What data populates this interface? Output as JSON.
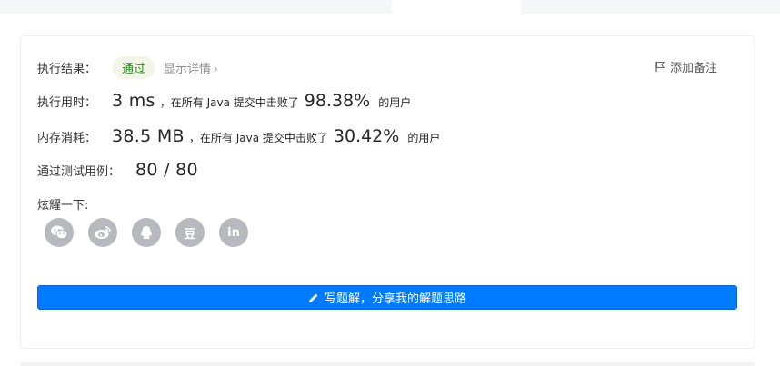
{
  "result": {
    "label": "执行结果：",
    "status": "通过",
    "details_link": "显示详情",
    "details_chevron": "›",
    "add_note": "添加备注"
  },
  "runtime": {
    "label": "执行用时：",
    "value": "3 ms",
    "text_before": "，在所有 Java 提交中击败了",
    "percent": "98.38%",
    "text_after": "的用户"
  },
  "memory": {
    "label": "内存消耗：",
    "value": "38.5 MB",
    "text_before": "，在所有 Java 提交中击败了",
    "percent": "30.42%",
    "text_after": "的用户"
  },
  "tests": {
    "label": "通过测试用例：",
    "value": "80 / 80"
  },
  "share": {
    "label": "炫耀一下:",
    "buttons": [
      {
        "name": "wechat-icon"
      },
      {
        "name": "weibo-icon"
      },
      {
        "name": "qq-icon"
      },
      {
        "name": "douban-icon",
        "glyph": "豆"
      },
      {
        "name": "linkedin-icon",
        "glyph": "in"
      }
    ]
  },
  "write_solution": {
    "label": "写题解，分享我的解题思路"
  },
  "colors": {
    "accent": "#007aff",
    "success": "#2d8a24",
    "icon_gray": "#b7b9be"
  }
}
